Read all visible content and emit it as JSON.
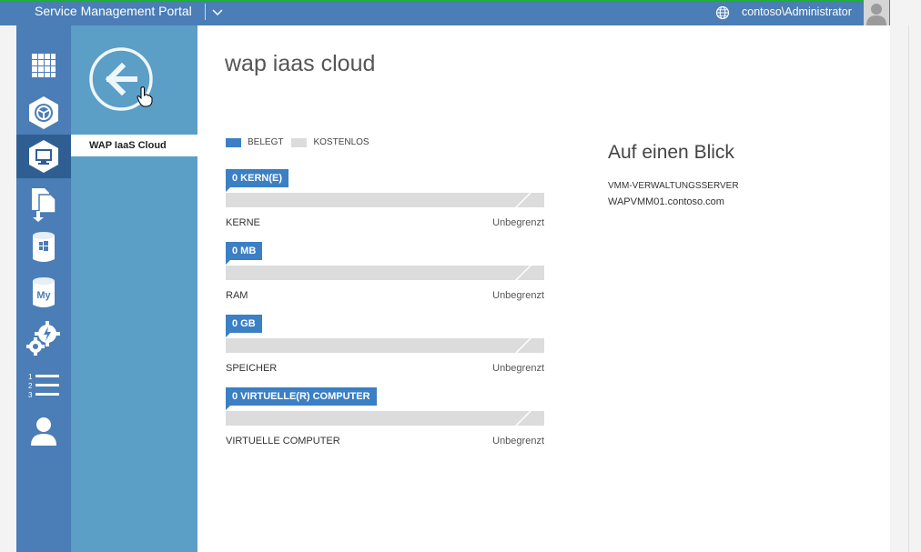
{
  "header": {
    "title": "Service Management Portal",
    "user": "contoso\\Administrator"
  },
  "rail": {
    "items": [
      {
        "name": "all-items-icon"
      },
      {
        "name": "web-sites-icon"
      },
      {
        "name": "virtual-machines-icon"
      },
      {
        "name": "copy-deploy-icon"
      },
      {
        "name": "sql-database-icon"
      },
      {
        "name": "mysql-database-icon"
      },
      {
        "name": "automation-icon"
      },
      {
        "name": "plans-icon"
      },
      {
        "name": "user-accounts-icon"
      }
    ]
  },
  "subnav": {
    "item": "WAP IaaS Cloud"
  },
  "main": {
    "title": "wap iaas cloud",
    "legend": {
      "used": "BELEGT",
      "free": "KOSTENLOS"
    },
    "meters": [
      {
        "tag": "0 KERN(E)",
        "label": "KERNE",
        "limit": "Unbegrenzt"
      },
      {
        "tag": "0 MB",
        "label": "RAM",
        "limit": "Unbegrenzt"
      },
      {
        "tag": "0 GB",
        "label": "SPEICHER",
        "limit": "Unbegrenzt"
      },
      {
        "tag": "0 VIRTUELLE(R) COMPUTER",
        "label": "VIRTUELLE COMPUTER",
        "limit": "Unbegrenzt"
      }
    ],
    "glance": {
      "heading": "Auf einen Blick",
      "key": "VMM-VERWALTUNGSSERVER",
      "value": "WAPVMM01.contoso.com"
    }
  },
  "colors": {
    "topbar": "#4b7db6",
    "rail": "#4b7db6",
    "subnav": "#5b9ec6",
    "used": "#3b7fc4",
    "free": "#dcdcdc"
  }
}
